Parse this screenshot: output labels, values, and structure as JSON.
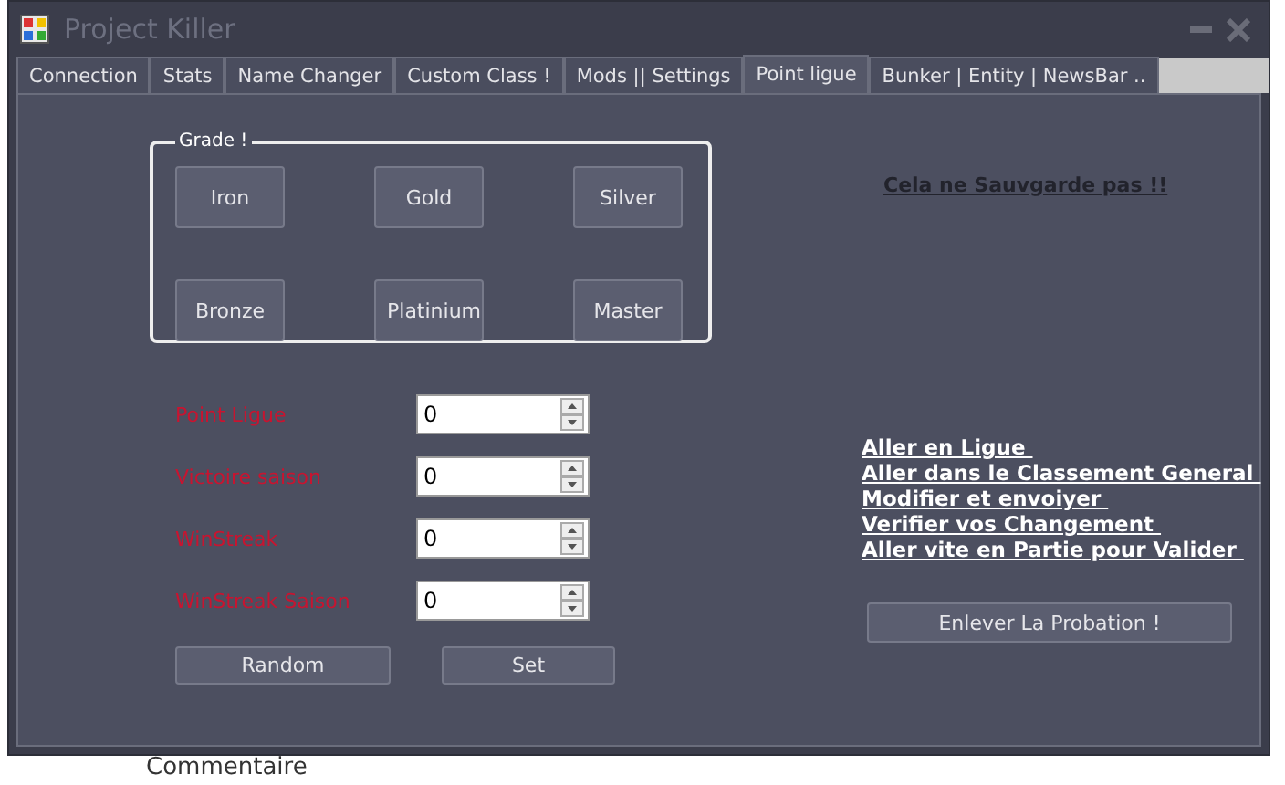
{
  "window": {
    "title": "Project Killer"
  },
  "tabs": [
    {
      "label": "Connection",
      "selected": false
    },
    {
      "label": "Stats",
      "selected": false
    },
    {
      "label": "Name Changer",
      "selected": false
    },
    {
      "label": "Custom Class !",
      "selected": false
    },
    {
      "label": "Mods || Settings",
      "selected": false
    },
    {
      "label": "Point ligue",
      "selected": true
    },
    {
      "label": "Bunker | Entity | NewsBar ..",
      "selected": false
    }
  ],
  "grade": {
    "title": "Grade !",
    "buttons": [
      "Iron",
      "Gold",
      "Silver",
      "Bronze",
      "Platinium",
      "Master"
    ]
  },
  "fields": [
    {
      "label": "Point Ligue",
      "value": "0"
    },
    {
      "label": "Victoire saison",
      "value": "0"
    },
    {
      "label": "WinStreak",
      "value": "0"
    },
    {
      "label": "WinStreak Saison",
      "value": "0"
    }
  ],
  "buttons": [
    "Random",
    "Set"
  ],
  "notice": "Cela ne Sauvgarde pas !!",
  "links": [
    "Aller en Ligue ",
    "Aller dans le Classement General ",
    "Modifier et envoiyer ",
    "Verifier vos Changement ",
    "Aller vite en Partie pour Valider "
  ],
  "probation_button": "Enlever La Probation !",
  "background_text": "Commentaire"
}
